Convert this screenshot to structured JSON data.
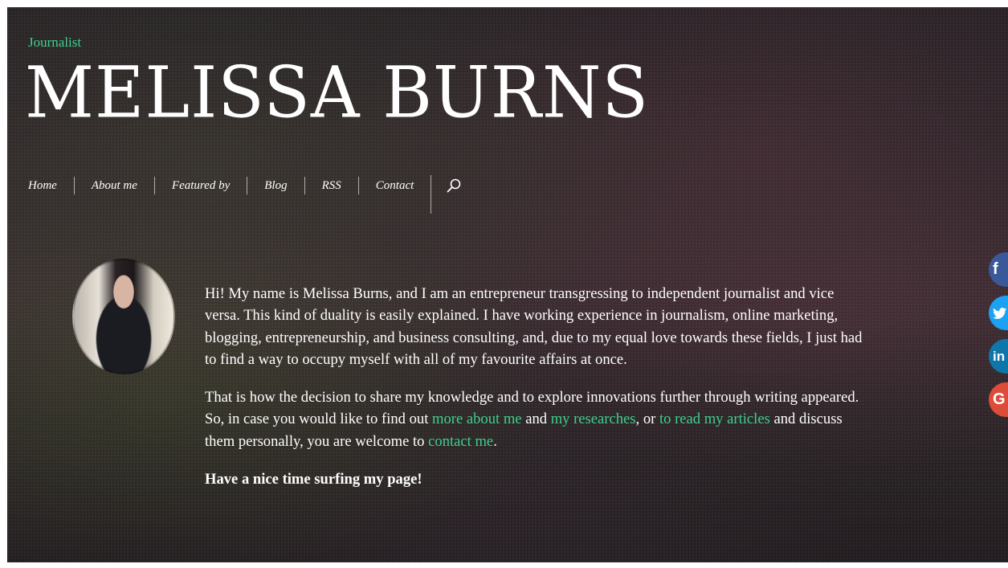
{
  "header": {
    "tagline": "Journalist",
    "title": "MELISSA BURNS"
  },
  "nav": {
    "items": [
      {
        "label": "Home"
      },
      {
        "label": "About me"
      },
      {
        "label": "Featured by"
      },
      {
        "label": "Blog"
      },
      {
        "label": "RSS"
      },
      {
        "label": "Contact"
      }
    ],
    "search_icon": "search-icon"
  },
  "bio": {
    "p1": "Hi! My name is Melissa Burns, and I am an entrepreneur transgressing to independent journalist and vice versa. This kind of duality is easily explained. I have working experience in journalism, online marketing, blogging, entrepreneurship, and business consulting, and, due to my equal love towards these fields, I just had to find a way to occupy myself with all of my favourite affairs at once.",
    "p2_a": "That is how the decision to share my knowledge  and to explore innovations further through writing appeared. So, in case you would like to find out ",
    "link_about": "more about me",
    "p2_b": " and ",
    "link_research": "my researches",
    "p2_c": ", or ",
    "link_articles": "to read my articles",
    "p2_d": " and discuss them personally, you are welcome to ",
    "link_contact": "contact me",
    "p2_e": ".",
    "closing": "Have a nice time surfing my page!"
  },
  "social": [
    {
      "icon": "facebook-icon",
      "glyph": "f",
      "color": "#3b5998"
    },
    {
      "icon": "twitter-icon",
      "glyph": "t",
      "color": "#1da1f2"
    },
    {
      "icon": "linkedin-icon",
      "glyph": "in",
      "color": "#0e76a8"
    },
    {
      "icon": "google-plus-icon",
      "glyph": "G",
      "color": "#dd4b39"
    }
  ],
  "colors": {
    "accent": "#3fcf8e"
  }
}
